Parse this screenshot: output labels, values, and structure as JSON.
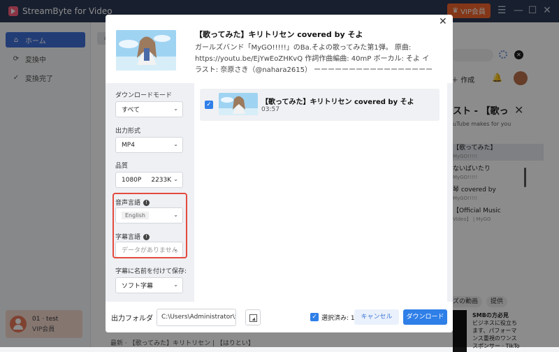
{
  "app": {
    "title": "StreamByte for Video",
    "vip_label": "VIP会員"
  },
  "sidebar": {
    "items": [
      {
        "label": "ホーム",
        "icon": "home-icon"
      },
      {
        "label": "変換中",
        "icon": "sync-icon"
      },
      {
        "label": "変換完了",
        "icon": "check-circle-icon"
      }
    ],
    "user": {
      "name": "01 · test",
      "status": "VIP会員"
    }
  },
  "background": {
    "create_label": "作成",
    "panel_title": "スト - 【歌っ",
    "panel_subtitle": "uTube makes for you",
    "list": [
      {
        "line1": "【歌ってみた】",
        "line2": "MyGO!!!!!"
      },
      {
        "line1": "ないばいたり",
        "line2": "MyGO!!!!!"
      },
      {
        "line1": "琴 covered by",
        "line2": "MyGO!!!!!"
      },
      {
        "line1": "【Official Music",
        "line2": "Video】 | MyGO"
      }
    ],
    "chips": [
      "ズの動画",
      "提供"
    ],
    "ad_title": "SMBの方必見",
    "ad_lines": [
      "ビジネスに役立ち",
      "ます、パフォーマ",
      "ンス重視のワンス",
      "スポンサー · TikTo"
    ],
    "bottom_text": "最新 · 【歌ってみた】キリトリセン | 【はりとい】"
  },
  "dialog": {
    "title": "【歌ってみた】キリトリセン covered by そよ",
    "description": "ガールズバンド「MyGO!!!!!」のBa.そよの歌ってみた第1弾。 原曲: https://youtu.be/EjYwEoZHKvQ 作詞作曲編曲: 40mP ボーカル: そよ イラスト: 奈原さき（@nahara2615） ーーーーーーーーーーーーーーーーーー...",
    "settings": {
      "download_mode": {
        "label": "ダウンロードモード",
        "value": "すべて"
      },
      "output_format": {
        "label": "出力形式",
        "value": "MP4"
      },
      "quality": {
        "label": "品質",
        "value": "1080P",
        "bitrate": "2233K"
      },
      "audio_language": {
        "label": "音声言語",
        "value": "English"
      },
      "subtitle_language": {
        "label": "字幕言語",
        "placeholder": "データがありません"
      },
      "subtitle_save": {
        "label": "字幕に名前を付けて保存:",
        "value": "ソフト字幕"
      }
    },
    "video": {
      "title": "【歌ってみた】キリトリセン covered by そよ",
      "duration": "03:57"
    },
    "footer": {
      "output_label": "出力フォルダ",
      "output_path": "C:\\Users\\Administrator\\Strea",
      "selected": "選択済み: 1",
      "cancel": "キャンセル",
      "download": "ダウンロード"
    }
  }
}
